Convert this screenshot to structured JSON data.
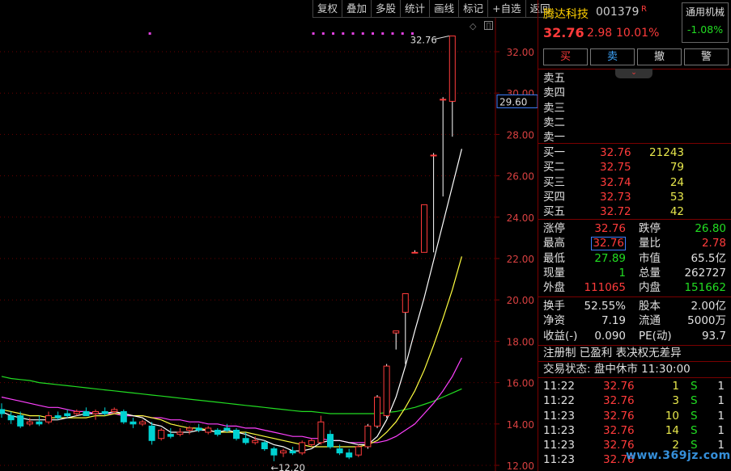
{
  "toolbar": [
    "复权",
    "叠加",
    "多股",
    "统计",
    "画线",
    "标记",
    "+自选",
    "返回"
  ],
  "axis": {
    "ticks": [
      "32.00",
      "30.00",
      "28.00",
      "26.00",
      "24.00",
      "22.00",
      "20.00",
      "18.00",
      "16.00",
      "14.00",
      "12.00"
    ],
    "current_price_tag": "29.60",
    "high_label": "32.76",
    "low_label": "←12.20"
  },
  "colors": {
    "up": "#ff3b3b",
    "down": "#00d2d2",
    "ma5": "#ffffff",
    "ma10": "#ffff40",
    "ma20": "#ff40ff",
    "ma60": "#22dd22",
    "border": "#7a0000"
  },
  "header": {
    "name": "腾达科技",
    "code": "001379",
    "flag": "R",
    "industry": "通用机械",
    "industry_change": "-1.08%",
    "price": "32.76",
    "change": "2.98",
    "change_pct": "10.01%"
  },
  "trade_buttons": [
    "买",
    "卖",
    "撤",
    "警"
  ],
  "asks": [
    {
      "label": "卖五",
      "price": "",
      "vol": ""
    },
    {
      "label": "卖四",
      "price": "",
      "vol": ""
    },
    {
      "label": "卖三",
      "price": "",
      "vol": ""
    },
    {
      "label": "卖二",
      "price": "",
      "vol": ""
    },
    {
      "label": "卖一",
      "price": "",
      "vol": ""
    }
  ],
  "bids": [
    {
      "label": "买一",
      "price": "32.76",
      "vol": "21243"
    },
    {
      "label": "买二",
      "price": "32.75",
      "vol": "79"
    },
    {
      "label": "买三",
      "price": "32.74",
      "vol": "24"
    },
    {
      "label": "买四",
      "price": "32.73",
      "vol": "53"
    },
    {
      "label": "买五",
      "price": "32.72",
      "vol": "42"
    }
  ],
  "stats": [
    {
      "l1": "涨停",
      "v1": "32.76",
      "c1": "red",
      "l2": "跌停",
      "v2": "26.80",
      "c2": "green"
    },
    {
      "l1": "最高",
      "v1": "32.76",
      "c1": "red",
      "l2": "量比",
      "v2": "2.78",
      "c2": "red"
    },
    {
      "l1": "最低",
      "v1": "27.89",
      "c1": "green",
      "l2": "市值",
      "v2": "65.5亿",
      "c2": "white"
    },
    {
      "l1": "现量",
      "v1": "1",
      "c1": "green",
      "l2": "总量",
      "v2": "262727",
      "c2": "white"
    },
    {
      "l1": "外盘",
      "v1": "111065",
      "c1": "red",
      "l2": "内盘",
      "v2": "151662",
      "c2": "green"
    }
  ],
  "fundamentals": [
    {
      "l1": "换手",
      "v1": "52.55%",
      "l2": "股本",
      "v2": "2.00亿"
    },
    {
      "l1": "净资",
      "v1": "7.19",
      "l2": "流通",
      "v2": "5000万"
    },
    {
      "l1": "收益(-)",
      "v1": "0.090",
      "l2": "PE(动)",
      "v2": "93.7"
    }
  ],
  "tags": "注册制 已盈利 表决权无差异",
  "trade_status": "交易状态: 盘中休市 11:30:00",
  "ticks_list": [
    {
      "time": "11:22",
      "price": "32.76",
      "vol": "1",
      "side": "S",
      "count": "1"
    },
    {
      "time": "11:22",
      "price": "32.76",
      "vol": "3",
      "side": "S",
      "count": "1"
    },
    {
      "time": "11:23",
      "price": "32.76",
      "vol": "10",
      "side": "S",
      "count": "1"
    },
    {
      "time": "11:23",
      "price": "32.76",
      "vol": "14",
      "side": "S",
      "count": "1"
    },
    {
      "time": "11:23",
      "price": "32.76",
      "vol": "2",
      "side": "S",
      "count": "1"
    },
    {
      "time": "11:23",
      "price": "32.76",
      "vol": "",
      "side": "",
      "count": ""
    }
  ],
  "watermark": "www.369jz.com",
  "chart_data": {
    "type": "candlestick",
    "ylim": [
      12.0,
      33.0
    ],
    "candles": [
      {
        "o": 14.7,
        "h": 15.0,
        "l": 14.3,
        "c": 14.5
      },
      {
        "o": 14.4,
        "h": 14.6,
        "l": 14.0,
        "c": 14.2
      },
      {
        "o": 14.4,
        "h": 14.6,
        "l": 13.8,
        "c": 13.9
      },
      {
        "o": 14.0,
        "h": 14.3,
        "l": 13.9,
        "c": 14.1
      },
      {
        "o": 14.1,
        "h": 14.4,
        "l": 13.9,
        "c": 14.0
      },
      {
        "o": 14.1,
        "h": 14.6,
        "l": 14.0,
        "c": 14.4
      },
      {
        "o": 14.4,
        "h": 14.6,
        "l": 14.2,
        "c": 14.3
      },
      {
        "o": 14.5,
        "h": 14.7,
        "l": 14.3,
        "c": 14.4
      },
      {
        "o": 14.5,
        "h": 14.7,
        "l": 14.4,
        "c": 14.6
      },
      {
        "o": 14.6,
        "h": 14.8,
        "l": 14.4,
        "c": 14.4
      },
      {
        "o": 14.5,
        "h": 14.7,
        "l": 14.2,
        "c": 14.6
      },
      {
        "o": 14.6,
        "h": 14.8,
        "l": 14.4,
        "c": 14.5
      },
      {
        "o": 14.6,
        "h": 14.8,
        "l": 14.5,
        "c": 14.7
      },
      {
        "o": 14.6,
        "h": 14.7,
        "l": 14.0,
        "c": 14.1
      },
      {
        "o": 14.1,
        "h": 14.3,
        "l": 13.8,
        "c": 14.0
      },
      {
        "o": 14.0,
        "h": 14.2,
        "l": 13.9,
        "c": 14.1
      },
      {
        "o": 13.9,
        "h": 14.1,
        "l": 13.0,
        "c": 13.2
      },
      {
        "o": 13.3,
        "h": 13.8,
        "l": 13.2,
        "c": 13.7
      },
      {
        "o": 13.5,
        "h": 13.8,
        "l": 13.3,
        "c": 13.4
      },
      {
        "o": 13.5,
        "h": 13.8,
        "l": 13.4,
        "c": 13.6
      },
      {
        "o": 13.7,
        "h": 13.9,
        "l": 13.5,
        "c": 13.8
      },
      {
        "o": 13.8,
        "h": 14.0,
        "l": 13.6,
        "c": 13.7
      },
      {
        "o": 13.6,
        "h": 13.9,
        "l": 13.5,
        "c": 13.8
      },
      {
        "o": 13.7,
        "h": 13.8,
        "l": 13.4,
        "c": 13.5
      },
      {
        "o": 13.8,
        "h": 14.0,
        "l": 13.6,
        "c": 13.7
      },
      {
        "o": 13.7,
        "h": 13.8,
        "l": 13.2,
        "c": 13.3
      },
      {
        "o": 13.3,
        "h": 13.6,
        "l": 13.0,
        "c": 13.1
      },
      {
        "o": 13.1,
        "h": 13.4,
        "l": 13.0,
        "c": 13.2
      },
      {
        "o": 13.1,
        "h": 13.2,
        "l": 12.7,
        "c": 12.8
      },
      {
        "o": 12.8,
        "h": 12.9,
        "l": 12.2,
        "c": 12.5
      },
      {
        "o": 12.6,
        "h": 12.8,
        "l": 12.4,
        "c": 12.7
      },
      {
        "o": 12.7,
        "h": 12.9,
        "l": 12.5,
        "c": 12.6
      },
      {
        "o": 12.6,
        "h": 13.2,
        "l": 12.5,
        "c": 13.1
      },
      {
        "o": 13.0,
        "h": 13.3,
        "l": 12.9,
        "c": 13.2
      },
      {
        "o": 13.1,
        "h": 14.4,
        "l": 13.0,
        "c": 14.1
      },
      {
        "o": 13.5,
        "h": 13.7,
        "l": 12.8,
        "c": 12.9
      },
      {
        "o": 12.8,
        "h": 13.0,
        "l": 12.5,
        "c": 12.6
      },
      {
        "o": 12.6,
        "h": 12.8,
        "l": 12.3,
        "c": 12.4
      },
      {
        "o": 12.5,
        "h": 13.0,
        "l": 12.4,
        "c": 12.9
      },
      {
        "o": 12.9,
        "h": 14.0,
        "l": 12.8,
        "c": 13.9
      },
      {
        "o": 13.9,
        "h": 15.4,
        "l": 13.8,
        "c": 15.3
      },
      {
        "o": 14.4,
        "h": 16.9,
        "l": 14.3,
        "c": 16.8
      },
      {
        "o": 18.4,
        "h": 18.5,
        "l": 17.6,
        "c": 18.5
      },
      {
        "o": 19.4,
        "h": 20.3,
        "l": 16.9,
        "c": 20.3
      },
      {
        "o": 22.3,
        "h": 22.4,
        "l": 22.3,
        "c": 22.3
      },
      {
        "o": 22.3,
        "h": 24.6,
        "l": 22.3,
        "c": 24.6
      },
      {
        "o": 27.0,
        "h": 27.1,
        "l": 22.3,
        "c": 27.0
      },
      {
        "o": 29.7,
        "h": 29.8,
        "l": 25.0,
        "c": 29.7
      },
      {
        "o": 29.6,
        "h": 32.76,
        "l": 27.89,
        "c": 32.76
      }
    ],
    "ma5": [
      14.6,
      14.4,
      14.3,
      14.2,
      14.2,
      14.2,
      14.2,
      14.3,
      14.4,
      14.5,
      14.5,
      14.5,
      14.6,
      14.5,
      14.4,
      14.3,
      14.0,
      13.9,
      13.6,
      13.6,
      13.6,
      13.7,
      13.7,
      13.6,
      13.7,
      13.6,
      13.5,
      13.3,
      13.2,
      13.0,
      12.9,
      12.7,
      12.7,
      12.8,
      13.1,
      13.2,
      13.2,
      13.1,
      13.0,
      13.0,
      13.4,
      14.2,
      15.3,
      16.8,
      18.5,
      20.1,
      21.9,
      23.7,
      25.5,
      27.3
    ],
    "ma10": [
      14.7,
      14.6,
      14.5,
      14.4,
      14.4,
      14.3,
      14.3,
      14.3,
      14.3,
      14.3,
      14.4,
      14.4,
      14.5,
      14.5,
      14.4,
      14.4,
      14.3,
      14.2,
      14.0,
      13.9,
      13.8,
      13.8,
      13.7,
      13.6,
      13.6,
      13.6,
      13.6,
      13.5,
      13.4,
      13.3,
      13.2,
      13.1,
      13.0,
      12.9,
      12.9,
      12.9,
      12.9,
      12.9,
      12.9,
      13.0,
      13.2,
      13.6,
      14.1,
      14.8,
      15.6,
      16.6,
      17.8,
      19.1,
      20.5,
      22.1
    ],
    "ma20": [
      15.3,
      15.2,
      15.1,
      15.0,
      14.9,
      14.8,
      14.8,
      14.7,
      14.6,
      14.6,
      14.5,
      14.5,
      14.5,
      14.4,
      14.4,
      14.4,
      14.3,
      14.3,
      14.2,
      14.2,
      14.1,
      14.1,
      14.0,
      14.0,
      13.9,
      13.9,
      13.8,
      13.8,
      13.7,
      13.6,
      13.5,
      13.4,
      13.4,
      13.3,
      13.3,
      13.2,
      13.2,
      13.1,
      13.1,
      13.1,
      13.1,
      13.2,
      13.4,
      13.7,
      14.0,
      14.5,
      15.0,
      15.6,
      16.3,
      17.2
    ],
    "ma60": [
      16.3,
      16.2,
      16.15,
      16.1,
      16.0,
      15.95,
      15.9,
      15.85,
      15.8,
      15.75,
      15.7,
      15.65,
      15.6,
      15.55,
      15.5,
      15.45,
      15.4,
      15.35,
      15.3,
      15.25,
      15.2,
      15.15,
      15.1,
      15.05,
      15.0,
      14.95,
      14.9,
      14.85,
      14.8,
      14.75,
      14.7,
      14.65,
      14.6,
      14.6,
      14.55,
      14.5,
      14.5,
      14.5,
      14.5,
      14.5,
      14.5,
      14.55,
      14.6,
      14.7,
      14.8,
      14.95,
      15.1,
      15.3,
      15.5,
      15.7
    ],
    "markers": [
      0.3,
      0.63,
      0.65,
      0.67,
      0.69,
      0.71,
      0.73,
      0.75,
      0.77,
      0.79,
      0.81,
      0.83
    ]
  }
}
